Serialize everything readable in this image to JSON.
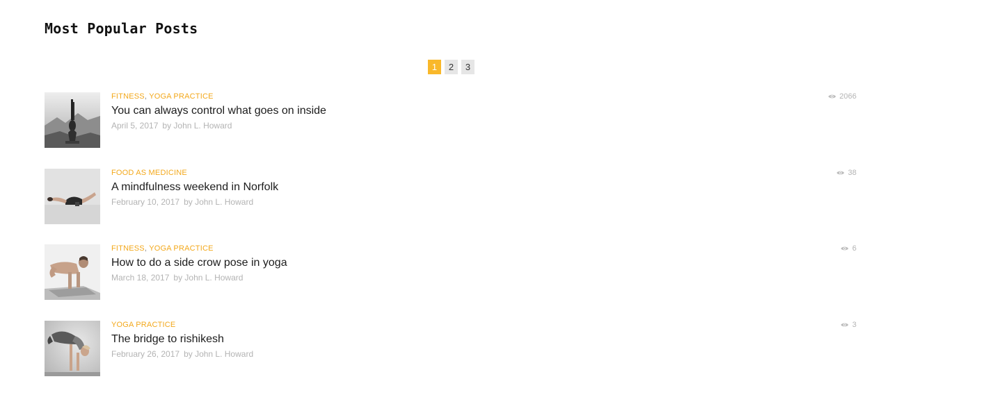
{
  "widget": {
    "title": "Most Popular Posts",
    "pagination": [
      "1",
      "2",
      "3"
    ],
    "active_page": "1",
    "accent_color": "#f9b82a"
  },
  "posts": [
    {
      "categories": [
        "FITNESS",
        "YOGA PRACTICE"
      ],
      "title": "You can always control what goes on inside",
      "date": "April 5, 2017",
      "author": "by John L. Howard",
      "views": "2066",
      "thumbnail_icon": "yoga-headstand-photo"
    },
    {
      "categories": [
        "FOOD AS MEDICINE"
      ],
      "title": "A mindfulness weekend in Norfolk",
      "date": "February 10, 2017",
      "author": "by John L. Howard",
      "views": "38",
      "thumbnail_icon": "yoga-backbend-photo"
    },
    {
      "categories": [
        "FITNESS",
        "YOGA PRACTICE"
      ],
      "title": "How to do a side crow pose in yoga",
      "date": "March 18, 2017",
      "author": "by John L. Howard",
      "views": "6",
      "thumbnail_icon": "side-crow-pose-photo"
    },
    {
      "categories": [
        "YOGA PRACTICE"
      ],
      "title": "The bridge to rishikesh",
      "date": "February 26, 2017",
      "author": "by John L. Howard",
      "views": "3",
      "thumbnail_icon": "crow-pose-photo"
    }
  ]
}
